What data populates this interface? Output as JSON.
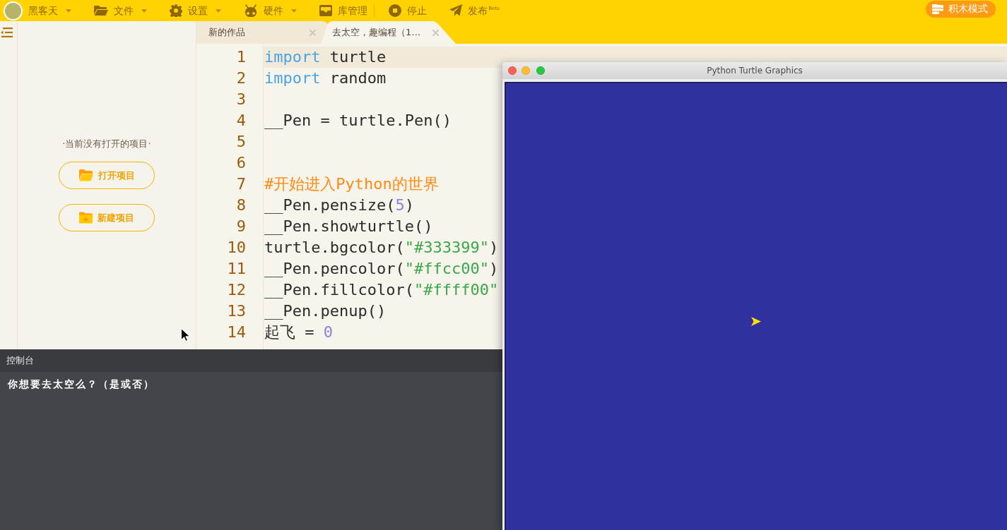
{
  "toolbar": {
    "groups": [
      [
        {
          "label": "黑客天",
          "dropdown": true
        },
        {
          "label": "文件",
          "dropdown": true
        },
        {
          "label": "设置",
          "dropdown": true
        },
        {
          "label": "硬件",
          "dropdown": true
        },
        {
          "label": "库管理",
          "dropdown": false
        }
      ],
      [
        {
          "label": "停止",
          "dropdown": false
        },
        {
          "label": "发布$^{Beta}$",
          "dropdown": false
        }
      ]
    ],
    "mode_button": "积木模式"
  },
  "sidebar": {
    "message": "·当前没有打开的项目·",
    "buttons": [
      "打开项目",
      "新建项目"
    ]
  },
  "tabs": [
    {
      "label": "新的作品",
      "selected": false
    },
    {
      "label": "去太空，趣编程（1…",
      "selected": true
    }
  ],
  "editor": {
    "lines": [
      {
        "number": "1",
        "current": true,
        "tokens": [
          {
            "kind": "keyword",
            "text": "import"
          },
          {
            "kind": "plain",
            "text": " turtle"
          }
        ]
      },
      {
        "number": "2",
        "current": false,
        "tokens": [
          {
            "kind": "keyword",
            "text": "import"
          },
          {
            "kind": "plain",
            "text": " random"
          }
        ]
      },
      {
        "number": "3",
        "current": false
      },
      {
        "number": "4",
        "current": false,
        "tokens": [
          {
            "kind": "plain",
            "text": "__Pen = turtle.Pen()"
          }
        ]
      },
      {
        "number": "5",
        "current": false
      },
      {
        "number": "6",
        "current": false
      },
      {
        "number": "7",
        "current": false,
        "tokens": [
          {
            "kind": "comment",
            "text": "#开始进入Python的世界"
          }
        ]
      },
      {
        "number": "8",
        "current": false,
        "tokens": [
          {
            "kind": "plain",
            "text": "__Pen.pensize("
          },
          {
            "kind": "number",
            "text": "5"
          },
          {
            "kind": "plain",
            "text": ")"
          }
        ]
      },
      {
        "number": "9",
        "current": false,
        "tokens": [
          {
            "kind": "plain",
            "text": "__Pen.showturtle()"
          }
        ]
      },
      {
        "number": "10",
        "current": false,
        "tokens": [
          {
            "kind": "plain",
            "text": "turtle.bgcolor("
          },
          {
            "kind": "string",
            "text": "\"#333399\""
          },
          {
            "kind": "plain",
            "text": ")"
          }
        ]
      },
      {
        "number": "11",
        "current": false,
        "tokens": [
          {
            "kind": "plain",
            "text": "__Pen.pencolor("
          },
          {
            "kind": "string",
            "text": "\"#ffcc00\""
          },
          {
            "kind": "plain",
            "text": ")"
          }
        ]
      },
      {
        "number": "12",
        "current": false,
        "tokens": [
          {
            "kind": "plain",
            "text": "__Pen.fillcolor("
          },
          {
            "kind": "string",
            "text": "\"#ffff00\""
          }
        ]
      },
      {
        "number": "13",
        "current": false,
        "tokens": [
          {
            "kind": "plain",
            "text": "__Pen.penup()"
          }
        ]
      },
      {
        "number": "14",
        "current": false,
        "tokens": [
          {
            "kind": "plain",
            "text": "起飞 = "
          },
          {
            "kind": "number",
            "text": "0"
          }
        ]
      }
    ]
  },
  "console": {
    "title": "控制台",
    "output": "你想要去太空么？（是或否）"
  },
  "turtle_window": {
    "title": "Python Turtle Graphics"
  }
}
